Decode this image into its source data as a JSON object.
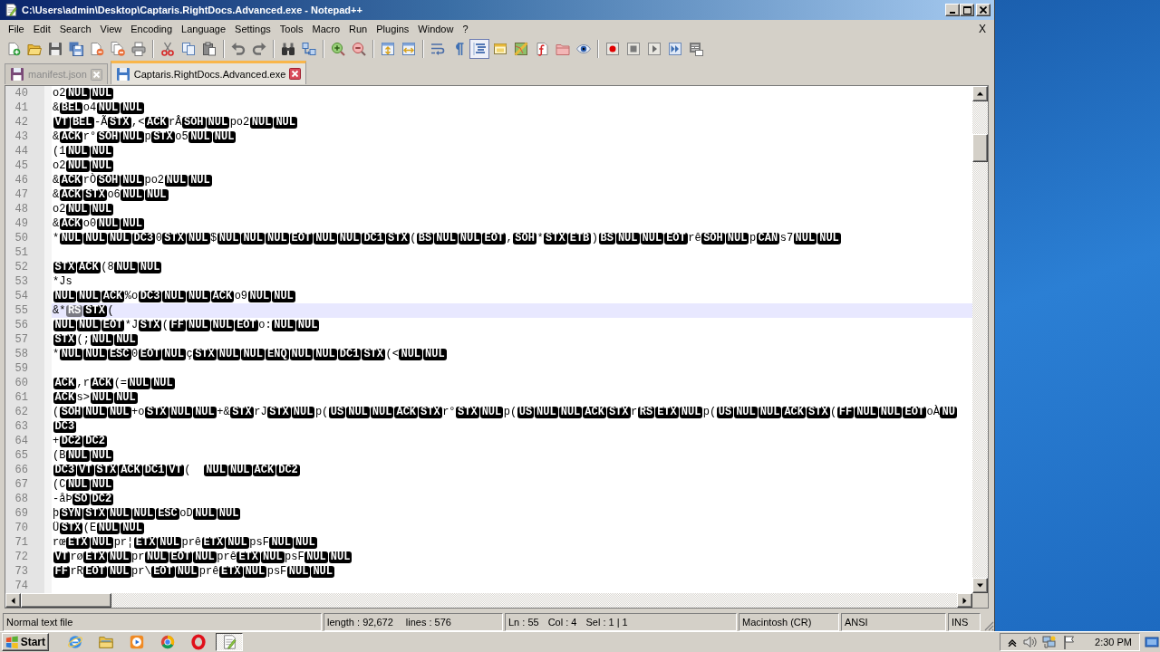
{
  "window": {
    "title": "C:\\Users\\admin\\Desktop\\Captaris.RightDocs.Advanced.exe - Notepad++"
  },
  "menu_bar": {
    "items": [
      "File",
      "Edit",
      "Search",
      "View",
      "Encoding",
      "Language",
      "Settings",
      "Tools",
      "Macro",
      "Run",
      "Plugins",
      "Window",
      "?"
    ],
    "close_document": "X"
  },
  "toolbar": {
    "groups": [
      [
        {
          "kind": "new",
          "pressed": false
        },
        {
          "kind": "open",
          "pressed": false
        },
        {
          "kind": "save",
          "pressed": false
        },
        {
          "kind": "save_all",
          "pressed": false
        },
        {
          "kind": "close",
          "pressed": false
        },
        {
          "kind": "close_all",
          "pressed": false
        },
        {
          "kind": "print",
          "pressed": false
        }
      ],
      [
        {
          "kind": "cut",
          "pressed": false
        },
        {
          "kind": "copy",
          "pressed": false
        },
        {
          "kind": "paste",
          "pressed": false
        }
      ],
      [
        {
          "kind": "undo",
          "pressed": false
        },
        {
          "kind": "redo",
          "pressed": false
        }
      ],
      [
        {
          "kind": "find",
          "pressed": false
        },
        {
          "kind": "replace",
          "pressed": false
        }
      ],
      [
        {
          "kind": "zoom_in",
          "pressed": false
        },
        {
          "kind": "zoom_out",
          "pressed": false
        }
      ],
      [
        {
          "kind": "sync_vertical",
          "pressed": false
        },
        {
          "kind": "sync_horizontal",
          "pressed": false
        }
      ],
      [
        {
          "kind": "word_wrap",
          "pressed": false
        },
        {
          "kind": "all_characters",
          "pressed": false
        },
        {
          "kind": "indent_guide",
          "pressed": true
        },
        {
          "kind": "user_language",
          "pressed": false
        },
        {
          "kind": "document_map",
          "pressed": false
        },
        {
          "kind": "function_list",
          "pressed": false
        },
        {
          "kind": "folder_workspace",
          "pressed": false
        },
        {
          "kind": "monitoring",
          "pressed": false
        }
      ],
      [
        {
          "kind": "record",
          "pressed": false
        },
        {
          "kind": "stop",
          "pressed": false
        },
        {
          "kind": "playback",
          "pressed": false
        },
        {
          "kind": "run_multiple",
          "pressed": false
        },
        {
          "kind": "save_macro",
          "pressed": false
        }
      ]
    ]
  },
  "tabs": [
    {
      "label": "manifest.json",
      "selected": false
    },
    {
      "label": "Captaris.RightDocs.Advanced.exe",
      "selected": true
    }
  ],
  "editor": {
    "lines": [
      {
        "number": "40",
        "current": false,
        "segments": [
          {
            "kind": "text",
            "text": "o2"
          },
          {
            "kind": "control",
            "text": "NUL"
          },
          {
            "kind": "control",
            "text": "NUL"
          }
        ]
      },
      {
        "number": "41",
        "current": false,
        "segments": [
          {
            "kind": "text",
            "text": "&"
          },
          {
            "kind": "control",
            "text": "BEL"
          },
          {
            "kind": "text",
            "text": "o4"
          },
          {
            "kind": "control",
            "text": "NUL"
          },
          {
            "kind": "control",
            "text": "NUL"
          }
        ]
      },
      {
        "number": "42",
        "current": false,
        "segments": [
          {
            "kind": "control",
            "text": "VT"
          },
          {
            "kind": "control",
            "text": "BEL"
          },
          {
            "kind": "text",
            "text": "-Ã"
          },
          {
            "kind": "control",
            "text": "STX"
          },
          {
            "kind": "text",
            "text": ",<"
          },
          {
            "kind": "control",
            "text": "ACK"
          },
          {
            "kind": "text",
            "text": "rÂ"
          },
          {
            "kind": "control",
            "text": "SOH"
          },
          {
            "kind": "control",
            "text": "NUL"
          },
          {
            "kind": "text",
            "text": "po2"
          },
          {
            "kind": "control",
            "text": "NUL"
          },
          {
            "kind": "control",
            "text": "NUL"
          }
        ]
      },
      {
        "number": "43",
        "current": false,
        "segments": [
          {
            "kind": "text",
            "text": "&"
          },
          {
            "kind": "control",
            "text": "ACK"
          },
          {
            "kind": "text",
            "text": "r°"
          },
          {
            "kind": "control",
            "text": "SOH"
          },
          {
            "kind": "control",
            "text": "NUL"
          },
          {
            "kind": "text",
            "text": "p"
          },
          {
            "kind": "control",
            "text": "STX"
          },
          {
            "kind": "text",
            "text": "o5"
          },
          {
            "kind": "control",
            "text": "NUL"
          },
          {
            "kind": "control",
            "text": "NUL"
          }
        ]
      },
      {
        "number": "44",
        "current": false,
        "segments": [
          {
            "kind": "text",
            "text": "(1"
          },
          {
            "kind": "control",
            "text": "NUL"
          },
          {
            "kind": "control",
            "text": "NUL"
          }
        ]
      },
      {
        "number": "45",
        "current": false,
        "segments": [
          {
            "kind": "text",
            "text": "o2"
          },
          {
            "kind": "control",
            "text": "NUL"
          },
          {
            "kind": "control",
            "text": "NUL"
          }
        ]
      },
      {
        "number": "46",
        "current": false,
        "segments": [
          {
            "kind": "text",
            "text": "&"
          },
          {
            "kind": "control",
            "text": "ACK"
          },
          {
            "kind": "text",
            "text": "rÒ"
          },
          {
            "kind": "control",
            "text": "SOH"
          },
          {
            "kind": "control",
            "text": "NUL"
          },
          {
            "kind": "text",
            "text": "po2"
          },
          {
            "kind": "control",
            "text": "NUL"
          },
          {
            "kind": "control",
            "text": "NUL"
          }
        ]
      },
      {
        "number": "47",
        "current": false,
        "segments": [
          {
            "kind": "text",
            "text": "&"
          },
          {
            "kind": "control",
            "text": "ACK"
          },
          {
            "kind": "control",
            "text": "STX"
          },
          {
            "kind": "text",
            "text": "o6"
          },
          {
            "kind": "control",
            "text": "NUL"
          },
          {
            "kind": "control",
            "text": "NUL"
          }
        ]
      },
      {
        "number": "48",
        "current": false,
        "segments": [
          {
            "kind": "text",
            "text": "o2"
          },
          {
            "kind": "control",
            "text": "NUL"
          },
          {
            "kind": "control",
            "text": "NUL"
          }
        ]
      },
      {
        "number": "49",
        "current": false,
        "segments": [
          {
            "kind": "text",
            "text": "&"
          },
          {
            "kind": "control",
            "text": "ACK"
          },
          {
            "kind": "text",
            "text": "o0"
          },
          {
            "kind": "control",
            "text": "NUL"
          },
          {
            "kind": "control",
            "text": "NUL"
          }
        ]
      },
      {
        "number": "50",
        "current": false,
        "segments": [
          {
            "kind": "text",
            "text": "*"
          },
          {
            "kind": "control",
            "text": "NUL"
          },
          {
            "kind": "control",
            "text": "NUL"
          },
          {
            "kind": "control",
            "text": "NUL"
          },
          {
            "kind": "control",
            "text": "DC3"
          },
          {
            "kind": "text",
            "text": "0"
          },
          {
            "kind": "control",
            "text": "STX"
          },
          {
            "kind": "control",
            "text": "NUL"
          },
          {
            "kind": "text",
            "text": "$"
          },
          {
            "kind": "control",
            "text": "NUL"
          },
          {
            "kind": "control",
            "text": "NUL"
          },
          {
            "kind": "control",
            "text": "NUL"
          },
          {
            "kind": "control",
            "text": "EOT"
          },
          {
            "kind": "control",
            "text": "NUL"
          },
          {
            "kind": "control",
            "text": "NUL"
          },
          {
            "kind": "control",
            "text": "DC1"
          },
          {
            "kind": "control",
            "text": "STX"
          },
          {
            "kind": "text",
            "text": "("
          },
          {
            "kind": "control",
            "text": "BS"
          },
          {
            "kind": "control",
            "text": "NUL"
          },
          {
            "kind": "control",
            "text": "NUL"
          },
          {
            "kind": "control",
            "text": "EOT"
          },
          {
            "kind": "text",
            "text": ","
          },
          {
            "kind": "control",
            "text": "SOH"
          },
          {
            "kind": "text",
            "text": "*"
          },
          {
            "kind": "control",
            "text": "STX"
          },
          {
            "kind": "control",
            "text": "ETB"
          },
          {
            "kind": "text",
            "text": ")"
          },
          {
            "kind": "control",
            "text": "BS"
          },
          {
            "kind": "control",
            "text": "NUL"
          },
          {
            "kind": "control",
            "text": "NUL"
          },
          {
            "kind": "control",
            "text": "EOT"
          },
          {
            "kind": "text",
            "text": "rê"
          },
          {
            "kind": "control",
            "text": "SOH"
          },
          {
            "kind": "control",
            "text": "NUL"
          },
          {
            "kind": "text",
            "text": "p"
          },
          {
            "kind": "control",
            "text": "CAN"
          },
          {
            "kind": "text",
            "text": "s7"
          },
          {
            "kind": "control",
            "text": "NUL"
          },
          {
            "kind": "control",
            "text": "NUL"
          }
        ]
      },
      {
        "number": "51",
        "current": false
      },
      {
        "number": "52",
        "current": false,
        "segments": [
          {
            "kind": "control",
            "text": "STX"
          },
          {
            "kind": "control",
            "text": "ACK"
          },
          {
            "kind": "text",
            "text": "(8"
          },
          {
            "kind": "control",
            "text": "NUL"
          },
          {
            "kind": "control",
            "text": "NUL"
          }
        ]
      },
      {
        "number": "53",
        "current": false,
        "segments": [
          {
            "kind": "text",
            "text": "*Js"
          }
        ]
      },
      {
        "number": "54",
        "current": false,
        "segments": [
          {
            "kind": "control",
            "text": "NUL"
          },
          {
            "kind": "control",
            "text": "NUL"
          },
          {
            "kind": "control",
            "text": "ACK"
          },
          {
            "kind": "text",
            "text": "%o"
          },
          {
            "kind": "control",
            "text": "DC3"
          },
          {
            "kind": "control",
            "text": "NUL"
          },
          {
            "kind": "control",
            "text": "NUL"
          },
          {
            "kind": "control",
            "text": "ACK"
          },
          {
            "kind": "text",
            "text": "o9"
          },
          {
            "kind": "control",
            "text": "NUL"
          },
          {
            "kind": "control",
            "text": "NUL"
          }
        ]
      },
      {
        "number": "55",
        "current": true,
        "segments": [
          {
            "kind": "text",
            "text": "&*"
          },
          {
            "kind": "selected_control",
            "text": "RS"
          },
          {
            "kind": "control",
            "text": "STX"
          },
          {
            "kind": "text",
            "text": "("
          }
        ]
      },
      {
        "number": "56",
        "current": false,
        "segments": [
          {
            "kind": "control",
            "text": "NUL"
          },
          {
            "kind": "control",
            "text": "NUL"
          },
          {
            "kind": "control",
            "text": "EOT"
          },
          {
            "kind": "text",
            "text": "*J"
          },
          {
            "kind": "control",
            "text": "STX"
          },
          {
            "kind": "text",
            "text": "("
          },
          {
            "kind": "control",
            "text": "FF"
          },
          {
            "kind": "control",
            "text": "NUL"
          },
          {
            "kind": "control",
            "text": "NUL"
          },
          {
            "kind": "control",
            "text": "EOT"
          },
          {
            "kind": "text",
            "text": "o:"
          },
          {
            "kind": "control",
            "text": "NUL"
          },
          {
            "kind": "control",
            "text": "NUL"
          }
        ]
      },
      {
        "number": "57",
        "current": false,
        "segments": [
          {
            "kind": "control",
            "text": "STX"
          },
          {
            "kind": "text",
            "text": "(;"
          },
          {
            "kind": "control",
            "text": "NUL"
          },
          {
            "kind": "control",
            "text": "NUL"
          }
        ]
      },
      {
        "number": "58",
        "current": false,
        "segments": [
          {
            "kind": "text",
            "text": "*"
          },
          {
            "kind": "control",
            "text": "NUL"
          },
          {
            "kind": "control",
            "text": "NUL"
          },
          {
            "kind": "control",
            "text": "ESC"
          },
          {
            "kind": "text",
            "text": "0"
          },
          {
            "kind": "control",
            "text": "EOT"
          },
          {
            "kind": "control",
            "text": "NUL"
          },
          {
            "kind": "text",
            "text": "ç"
          },
          {
            "kind": "control",
            "text": "STX"
          },
          {
            "kind": "control",
            "text": "NUL"
          },
          {
            "kind": "control",
            "text": "NUL"
          },
          {
            "kind": "control",
            "text": "ENQ"
          },
          {
            "kind": "control",
            "text": "NUL"
          },
          {
            "kind": "control",
            "text": "NUL"
          },
          {
            "kind": "control",
            "text": "DC1"
          },
          {
            "kind": "control",
            "text": "STX"
          },
          {
            "kind": "text",
            "text": "(<"
          },
          {
            "kind": "control",
            "text": "NUL"
          },
          {
            "kind": "control",
            "text": "NUL"
          }
        ]
      },
      {
        "number": "59",
        "current": false
      },
      {
        "number": "60",
        "current": false,
        "segments": [
          {
            "kind": "control",
            "text": "ACK"
          },
          {
            "kind": "text",
            "text": ",r"
          },
          {
            "kind": "control",
            "text": "ACK"
          },
          {
            "kind": "text",
            "text": "(="
          },
          {
            "kind": "control",
            "text": "NUL"
          },
          {
            "kind": "control",
            "text": "NUL"
          }
        ]
      },
      {
        "number": "61",
        "current": false,
        "segments": [
          {
            "kind": "control",
            "text": "ACK"
          },
          {
            "kind": "text",
            "text": "s>"
          },
          {
            "kind": "control",
            "text": "NUL"
          },
          {
            "kind": "control",
            "text": "NUL"
          }
        ]
      },
      {
        "number": "62",
        "current": false,
        "segments": [
          {
            "kind": "text",
            "text": "("
          },
          {
            "kind": "control",
            "text": "SOH"
          },
          {
            "kind": "control",
            "text": "NUL"
          },
          {
            "kind": "control",
            "text": "NUL"
          },
          {
            "kind": "text",
            "text": "+o"
          },
          {
            "kind": "control",
            "text": "STX"
          },
          {
            "kind": "control",
            "text": "NUL"
          },
          {
            "kind": "control",
            "text": "NUL"
          },
          {
            "kind": "text",
            "text": "+&"
          },
          {
            "kind": "control",
            "text": "STX"
          },
          {
            "kind": "text",
            "text": "rJ"
          },
          {
            "kind": "control",
            "text": "STX"
          },
          {
            "kind": "control",
            "text": "NUL"
          },
          {
            "kind": "text",
            "text": "p("
          },
          {
            "kind": "control",
            "text": "US"
          },
          {
            "kind": "control",
            "text": "NUL"
          },
          {
            "kind": "control",
            "text": "NUL"
          },
          {
            "kind": "control",
            "text": "ACK"
          },
          {
            "kind": "control",
            "text": "STX"
          },
          {
            "kind": "text",
            "text": "r°"
          },
          {
            "kind": "control",
            "text": "STX"
          },
          {
            "kind": "control",
            "text": "NUL"
          },
          {
            "kind": "text",
            "text": "p("
          },
          {
            "kind": "control",
            "text": "US"
          },
          {
            "kind": "control",
            "text": "NUL"
          },
          {
            "kind": "control",
            "text": "NUL"
          },
          {
            "kind": "control",
            "text": "ACK"
          },
          {
            "kind": "control",
            "text": "STX"
          },
          {
            "kind": "text",
            "text": "r"
          },
          {
            "kind": "control",
            "text": "RS"
          },
          {
            "kind": "control",
            "text": "ETX"
          },
          {
            "kind": "control",
            "text": "NUL"
          },
          {
            "kind": "text",
            "text": "p("
          },
          {
            "kind": "control",
            "text": "US"
          },
          {
            "kind": "control",
            "text": "NUL"
          },
          {
            "kind": "control",
            "text": "NUL"
          },
          {
            "kind": "control",
            "text": "ACK"
          },
          {
            "kind": "control",
            "text": "STX"
          },
          {
            "kind": "text",
            "text": "("
          },
          {
            "kind": "control",
            "text": "FF"
          },
          {
            "kind": "control",
            "text": "NUL"
          },
          {
            "kind": "control",
            "text": "NUL"
          },
          {
            "kind": "control",
            "text": "EOT"
          },
          {
            "kind": "text",
            "text": "oÀ"
          },
          {
            "kind": "control",
            "text": "NU"
          }
        ]
      },
      {
        "number": "63",
        "current": false,
        "segments": [
          {
            "kind": "control",
            "text": "DC3"
          }
        ]
      },
      {
        "number": "64",
        "current": false,
        "segments": [
          {
            "kind": "text",
            "text": "+"
          },
          {
            "kind": "control",
            "text": "DC2"
          },
          {
            "kind": "control",
            "text": "DC2"
          }
        ]
      },
      {
        "number": "65",
        "current": false,
        "segments": [
          {
            "kind": "text",
            "text": "(B"
          },
          {
            "kind": "control",
            "text": "NUL"
          },
          {
            "kind": "control",
            "text": "NUL"
          }
        ]
      },
      {
        "number": "66",
        "current": false,
        "segments": [
          {
            "kind": "control",
            "text": "DC3"
          },
          {
            "kind": "control",
            "text": "VT"
          },
          {
            "kind": "control",
            "text": "STX"
          },
          {
            "kind": "control",
            "text": "ACK"
          },
          {
            "kind": "control",
            "text": "DC1"
          },
          {
            "kind": "control",
            "text": "VT"
          },
          {
            "kind": "text",
            "text": "(  "
          },
          {
            "kind": "control",
            "text": "NUL"
          },
          {
            "kind": "control",
            "text": "NUL"
          },
          {
            "kind": "control",
            "text": "ACK"
          },
          {
            "kind": "control",
            "text": "DC2"
          }
        ]
      },
      {
        "number": "67",
        "current": false,
        "segments": [
          {
            "kind": "text",
            "text": "(C"
          },
          {
            "kind": "control",
            "text": "NUL"
          },
          {
            "kind": "control",
            "text": "NUL"
          }
        ]
      },
      {
        "number": "68",
        "current": false,
        "segments": [
          {
            "kind": "text",
            "text": "-åÞ"
          },
          {
            "kind": "control",
            "text": "SO"
          },
          {
            "kind": "control",
            "text": "DC2"
          }
        ]
      },
      {
        "number": "69",
        "current": false,
        "segments": [
          {
            "kind": "text",
            "text": "þ"
          },
          {
            "kind": "control",
            "text": "SYN"
          },
          {
            "kind": "control",
            "text": "STX"
          },
          {
            "kind": "control",
            "text": "NUL"
          },
          {
            "kind": "control",
            "text": "NUL"
          },
          {
            "kind": "control",
            "text": "ESC"
          },
          {
            "kind": "text",
            "text": "oD"
          },
          {
            "kind": "control",
            "text": "NUL"
          },
          {
            "kind": "control",
            "text": "NUL"
          }
        ]
      },
      {
        "number": "70",
        "current": false,
        "segments": [
          {
            "kind": "text",
            "text": "Ü"
          },
          {
            "kind": "control",
            "text": "STX"
          },
          {
            "kind": "text",
            "text": "(E"
          },
          {
            "kind": "control",
            "text": "NUL"
          },
          {
            "kind": "control",
            "text": "NUL"
          }
        ]
      },
      {
        "number": "71",
        "current": false,
        "segments": [
          {
            "kind": "text",
            "text": "rœ"
          },
          {
            "kind": "control",
            "text": "ETX"
          },
          {
            "kind": "control",
            "text": "NUL"
          },
          {
            "kind": "text",
            "text": "pr¦"
          },
          {
            "kind": "control",
            "text": "ETX"
          },
          {
            "kind": "control",
            "text": "NUL"
          },
          {
            "kind": "text",
            "text": "prê"
          },
          {
            "kind": "control",
            "text": "ETX"
          },
          {
            "kind": "control",
            "text": "NUL"
          },
          {
            "kind": "text",
            "text": "psF"
          },
          {
            "kind": "control",
            "text": "NUL"
          },
          {
            "kind": "control",
            "text": "NUL"
          }
        ]
      },
      {
        "number": "72",
        "current": false,
        "segments": [
          {
            "kind": "control",
            "text": "VT"
          },
          {
            "kind": "text",
            "text": "rø"
          },
          {
            "kind": "control",
            "text": "ETX"
          },
          {
            "kind": "control",
            "text": "NUL"
          },
          {
            "kind": "text",
            "text": "pr"
          },
          {
            "kind": "control",
            "text": "NUL"
          },
          {
            "kind": "control",
            "text": "EOT"
          },
          {
            "kind": "control",
            "text": "NUL"
          },
          {
            "kind": "text",
            "text": "prê"
          },
          {
            "kind": "control",
            "text": "ETX"
          },
          {
            "kind": "control",
            "text": "NUL"
          },
          {
            "kind": "text",
            "text": "psF"
          },
          {
            "kind": "control",
            "text": "NUL"
          },
          {
            "kind": "control",
            "text": "NUL"
          }
        ]
      },
      {
        "number": "73",
        "current": false,
        "segments": [
          {
            "kind": "control",
            "text": "FF"
          },
          {
            "kind": "text",
            "text": "rR"
          },
          {
            "kind": "control",
            "text": "EOT"
          },
          {
            "kind": "control",
            "text": "NUL"
          },
          {
            "kind": "text",
            "text": "pr\\"
          },
          {
            "kind": "control",
            "text": "EOT"
          },
          {
            "kind": "control",
            "text": "NUL"
          },
          {
            "kind": "text",
            "text": "prê"
          },
          {
            "kind": "control",
            "text": "ETX"
          },
          {
            "kind": "control",
            "text": "NUL"
          },
          {
            "kind": "text",
            "text": "psF"
          },
          {
            "kind": "control",
            "text": "NUL"
          },
          {
            "kind": "control",
            "text": "NUL"
          }
        ]
      },
      {
        "number": "74",
        "current": false
      }
    ]
  },
  "status_bar": {
    "file_type": "Normal text file",
    "length": "length : 92,672",
    "lines": "lines : 576",
    "line": "Ln : 55",
    "column": "Col : 4",
    "selection": "Sel : 1 | 1",
    "line_ending": "Macintosh (CR)",
    "encoding": "ANSI",
    "mode": "INS"
  },
  "taskbar": {
    "start": "Start",
    "apps": [
      {
        "kind": "globe",
        "active": false
      },
      {
        "kind": "folder",
        "active": false
      },
      {
        "kind": "player",
        "active": false
      },
      {
        "kind": "wheel",
        "active": false
      },
      {
        "kind": "ring",
        "active": false
      },
      {
        "kind": "notepad",
        "active": true
      }
    ],
    "clock": "2:30 PM"
  }
}
